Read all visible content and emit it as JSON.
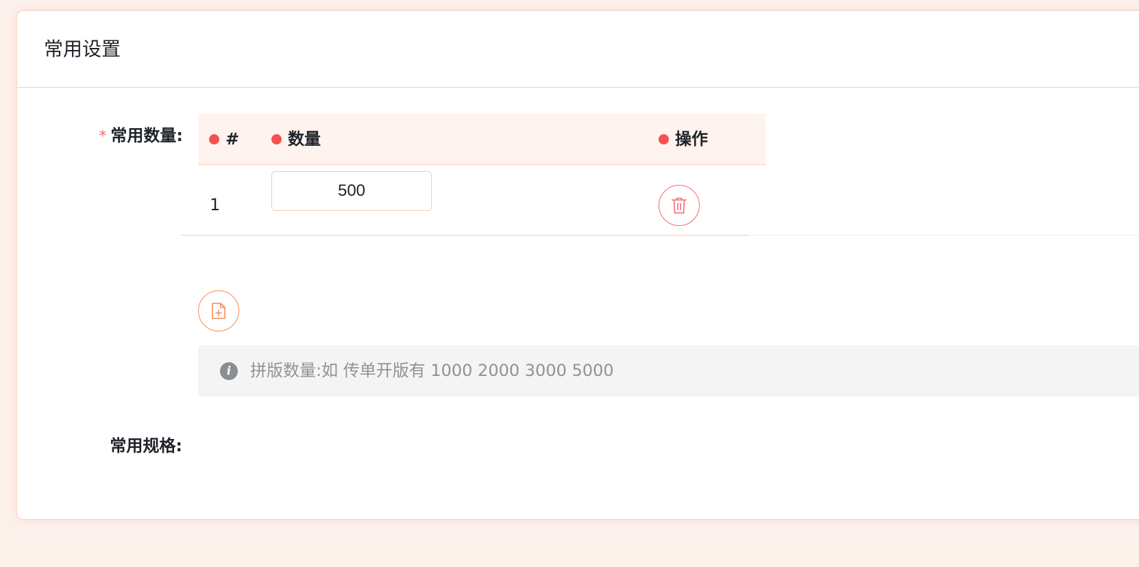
{
  "card": {
    "title": "常用设置"
  },
  "form": {
    "required_mark": "*",
    "common_quantity_label": "常用数量:",
    "common_spec_label": "常用规格:"
  },
  "table": {
    "headers": {
      "index": "#",
      "quantity": "数量",
      "operation": "操作"
    },
    "rows": [
      {
        "index": "1",
        "quantity": "500"
      }
    ]
  },
  "icons": {
    "delete": "trash-icon",
    "add": "file-add-icon",
    "info": "info-icon"
  },
  "hint": {
    "icon_glyph": "i",
    "text": "拼版数量:如 传单开版有 1000 2000 3000 5000"
  },
  "colors": {
    "accent": "#f58a57",
    "danger": "#f55151",
    "header_bg": "#fef3ef",
    "hint_bg": "#f4f4f5"
  }
}
